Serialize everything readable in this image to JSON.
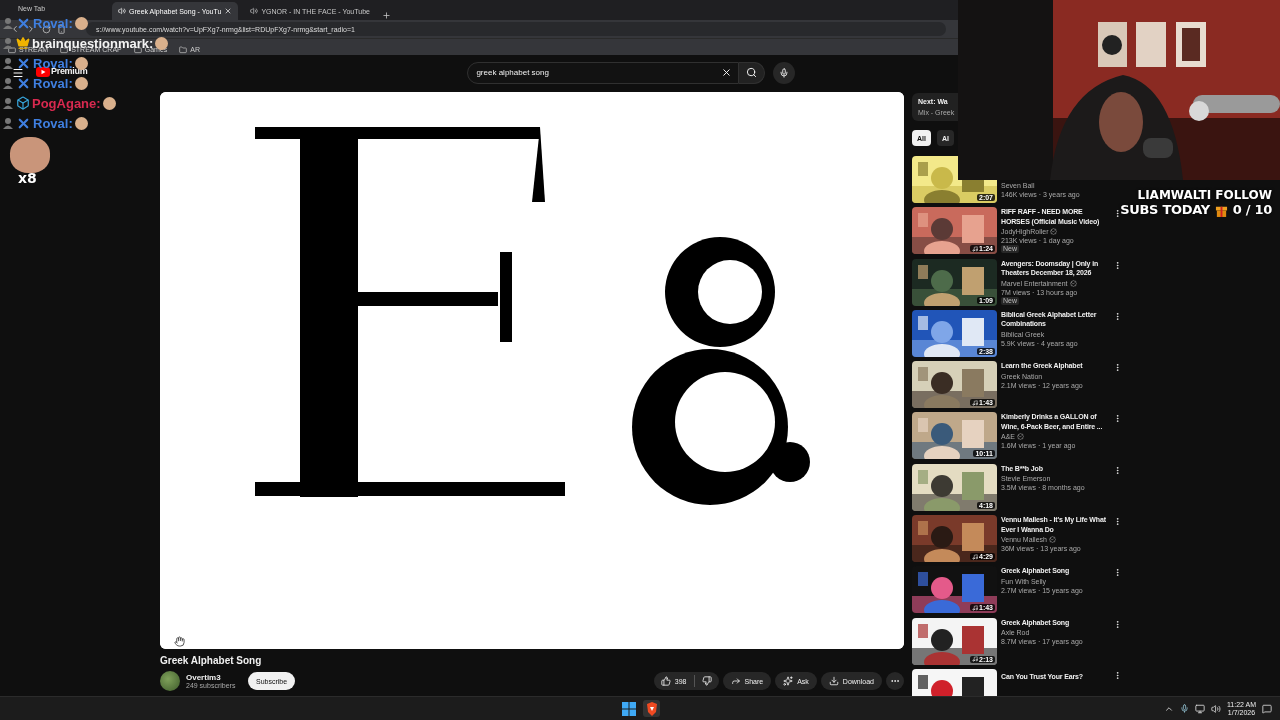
{
  "browser": {
    "tabs": [
      {
        "label": "New Tab",
        "selected": false,
        "audio": false
      },
      {
        "label": "Greek Alphabet Song - YouTu",
        "selected": true,
        "audio": true
      },
      {
        "label": "YGNOR - IN THE FACE - YouTube",
        "selected": false,
        "audio": true
      }
    ],
    "url": "s://www.youtube.com/watch?v=UpFXg7-nrmg&list=RDUpFXg7-nrmg&start_radio=1",
    "bookmarks": [
      "STREAM",
      "STREAM CRAP",
      "Games",
      "AR"
    ]
  },
  "youtube": {
    "logo_label": "Premium",
    "search": {
      "value": "greek alphabet song"
    },
    "video": {
      "title": "Greek Alphabet Song",
      "channel": "Overtim3",
      "subscribers": "249 subscribers",
      "subscribe": "Subscribe",
      "likes": "398",
      "actions": [
        {
          "kind": "share",
          "label": "Share"
        },
        {
          "kind": "ask",
          "label": "Ask"
        },
        {
          "kind": "download",
          "label": "Download"
        }
      ]
    },
    "sidebar": {
      "next_title": "Next: Wa",
      "next_sub": "Mix - Greek",
      "chips": [
        {
          "label": "All",
          "selected": true
        },
        {
          "label": "Al",
          "selected": false
        }
      ],
      "items": [
        {
          "channel": "Seven Ball",
          "verified": false,
          "meta": "146K views · 3 years ago",
          "duration": "2:07",
          "music": false
        },
        {
          "title": "RIFF RAFF - NEED MORE HORSES (Official Music Video)",
          "channel": "JodyHighRoller",
          "verified": true,
          "meta": "213K views · 1 day ago",
          "badge": "New",
          "duration": "1:24",
          "music": true
        },
        {
          "title": "Avengers: Doomsday | Only in Theaters December 18, 2026",
          "channel": "Marvel Entertainment",
          "verified": true,
          "meta": "7M views · 13 hours ago",
          "badge": "New",
          "duration": "1:09",
          "music": false
        },
        {
          "title": "Biblical Greek Alphabet Letter Combinations",
          "channel": "Biblical Greek",
          "verified": false,
          "meta": "5.9K views · 4 years ago",
          "duration": "2:38",
          "music": false
        },
        {
          "title": "Learn the Greek Alphabet",
          "channel": "Greek Nation",
          "verified": false,
          "meta": "2.1M views · 12 years ago",
          "duration": "1:43",
          "music": true
        },
        {
          "title": "Kimberly Drinks a GALLON of Wine, 6-Pack Beer, and Entire ...",
          "channel": "A&E",
          "verified": true,
          "meta": "1.6M views · 1 year ago",
          "duration": "10:11",
          "music": false
        },
        {
          "title": "The B**b Job",
          "channel": "Stevie Emerson",
          "verified": false,
          "meta": "3.5M views · 8 months ago",
          "duration": "4:18",
          "music": false
        },
        {
          "title": "Vennu Mallesh - It's My Life What Ever I Wanna Do",
          "channel": "Vennu Mallesh",
          "verified": true,
          "meta": "36M views · 13 years ago",
          "duration": "4:29",
          "music": true
        },
        {
          "title": "Greek Alphabet Song",
          "channel": "Fun With Selly",
          "verified": false,
          "meta": "2.7M views · 15 years ago",
          "duration": "1:43",
          "music": true
        },
        {
          "title": "Greek Alphabet Song",
          "channel": "Axle Rod",
          "verified": false,
          "meta": "8.7M views · 17 years ago",
          "duration": "2:13",
          "music": true
        },
        {
          "title": "Can You Trust Your Ears?"
        }
      ]
    }
  },
  "chat": {
    "messages": [
      {
        "user": "Roval:",
        "color": "#3f7fe0",
        "kind": "cross"
      },
      {
        "user": "brainquestionmark:",
        "color": "#f4f4f4",
        "kind": "crown"
      },
      {
        "user": "Roval:",
        "color": "#3f7fe0",
        "kind": "cross"
      },
      {
        "user": "Roval:",
        "color": "#3f7fe0",
        "kind": "cross"
      },
      {
        "user": "PogAgane:",
        "color": "#d8294f",
        "kind": "cube"
      },
      {
        "user": "Roval:",
        "color": "#3f7fe0",
        "kind": "cross"
      }
    ],
    "combo": "x8"
  },
  "stream_overlay": {
    "line1": "LIAMWALTI FOLLOW",
    "line2": "SUBS TODAY",
    "count": "0 / 10"
  },
  "taskbar": {
    "time": "11:22 AM",
    "date": "1/7/2026"
  }
}
